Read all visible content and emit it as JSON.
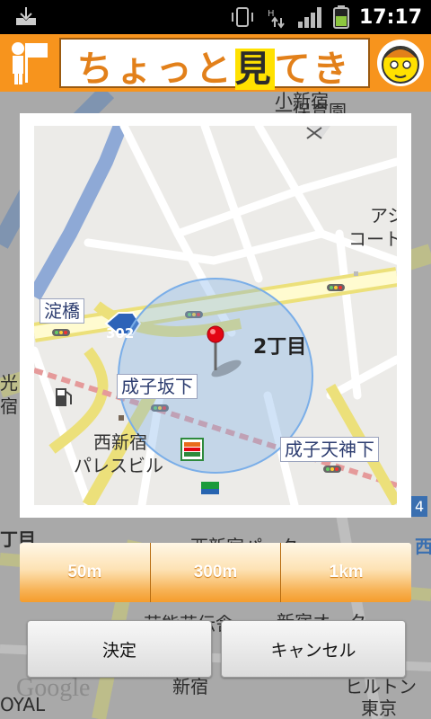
{
  "status_bar": {
    "time": "17:17",
    "icons": [
      "download-icon",
      "vibrate-icon",
      "data-arrows-icon",
      "signal-icon",
      "battery-icon"
    ]
  },
  "header": {
    "title_pre": "ちょっと",
    "title_mid": "見",
    "title_post": "てきて"
  },
  "background_map": {
    "labels": {
      "hoikuen_top": "小新宿",
      "hoikuen": "一保育園",
      "ashi": "アシ",
      "kou_left": "光目",
      "bldg_left": "宿ビル",
      "chome_left": "丁目",
      "park": "西新宿パーク",
      "hall": "芸能花伝舎",
      "oak": "新宿オーク",
      "shinjuku": "新宿",
      "hilton": "ヒルトン",
      "tokyo": "東京",
      "oyal": "OYAL",
      "route_right": "4",
      "right_nishi": "西",
      "google": "Google"
    }
  },
  "map": {
    "labels": {
      "yodobashi": "淀橋",
      "route_302": "302",
      "area": "2丁目",
      "narikozakashita": "成子坂下",
      "nishishinjuku_1": "西新宿",
      "nishishinjuku_2": "パレスビル",
      "narikotenjinshita": "成子天神下",
      "ashi_1": "アシ",
      "ashi_2": "コート西",
      "familymart": "FamilyMart"
    }
  },
  "radius_options": [
    {
      "label": "50m"
    },
    {
      "label": "300m"
    },
    {
      "label": "1km"
    }
  ],
  "buttons": {
    "ok": "決定",
    "cancel": "キャンセル"
  },
  "colors": {
    "header_orange": "#f7941d",
    "radius_circle": "#7aaee8",
    "pin_red": "#e30613"
  }
}
